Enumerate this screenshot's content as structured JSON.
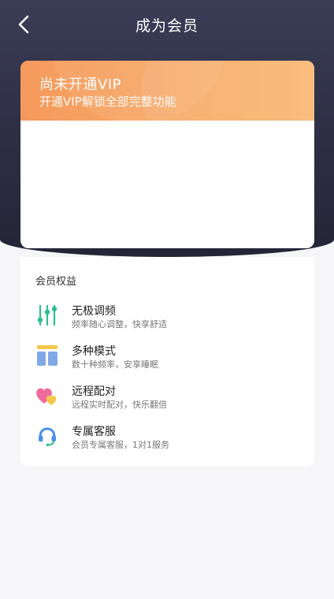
{
  "nav": {
    "title": "成为会员",
    "back_icon": "chevron-left-icon"
  },
  "vip_card": {
    "title": "尚未开通VIP",
    "subtitle": "开通VIP解锁全部完整功能"
  },
  "benefits": {
    "heading": "会员权益",
    "items": [
      {
        "name": "无极调频",
        "desc": "频率随心调整，快享舒适",
        "icon": "sliders-icon"
      },
      {
        "name": "多种模式",
        "desc": "数十种频率，安享睡眠",
        "icon": "layout-icon"
      },
      {
        "name": "远程配对",
        "desc": "远程实时配对，快乐翻倍",
        "icon": "hearts-icon"
      },
      {
        "name": "专属客服",
        "desc": "会员专属客服，1对1服务",
        "icon": "headset-icon"
      }
    ]
  },
  "colors": {
    "header_dark": "#2d2e44",
    "vip_orange": "#f59a5c",
    "icon_green": "#2fbf8f",
    "icon_blue": "#7fa9e6",
    "icon_yellow": "#f6c64a",
    "icon_pink": "#f06aa0"
  }
}
